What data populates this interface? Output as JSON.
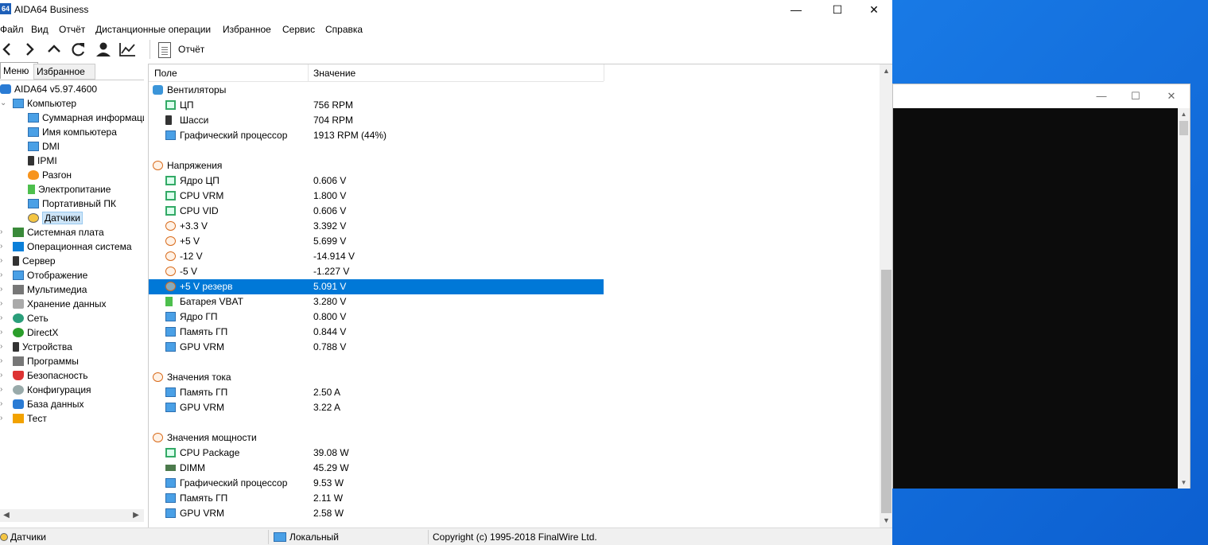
{
  "window": {
    "title": "AIDA64 Business",
    "icon_text": "64",
    "minimize": "—",
    "maximize": "☐",
    "close": "✕"
  },
  "menu": [
    "Файл",
    "Вид",
    "Отчёт",
    "Дистанционные операции",
    "Избранное",
    "Сервис",
    "Справка"
  ],
  "toolbar": {
    "report_label": "Отчёт",
    "buttons": [
      "back-icon",
      "forward-icon",
      "up-icon",
      "refresh-icon",
      "user-icon",
      "chart-icon"
    ]
  },
  "tabs": {
    "menu": "Меню",
    "favorites": "Избранное"
  },
  "tree": {
    "root": "AIDA64 v5.97.4600",
    "computer": "Компьютер",
    "computer_children": [
      {
        "label": "Суммарная информация",
        "icon": "monitor-icon"
      },
      {
        "label": "Имя компьютера",
        "icon": "monitor-icon"
      },
      {
        "label": "DMI",
        "icon": "monitor-icon"
      },
      {
        "label": "IPMI",
        "icon": "tower-icon"
      },
      {
        "label": "Разгон",
        "icon": "fire-icon"
      },
      {
        "label": "Электропитание",
        "icon": "battery-icon"
      },
      {
        "label": "Портативный ПК",
        "icon": "monitor-icon"
      },
      {
        "label": "Датчики",
        "icon": "gauge-icon"
      }
    ],
    "top_items": [
      {
        "label": "Системная плата",
        "icon": "motherboard-icon"
      },
      {
        "label": "Операционная система",
        "icon": "windows-icon"
      },
      {
        "label": "Сервер",
        "icon": "tower-icon"
      },
      {
        "label": "Отображение",
        "icon": "monitor-icon"
      },
      {
        "label": "Мультимедиа",
        "icon": "speaker-icon"
      },
      {
        "label": "Хранение данных",
        "icon": "disk-icon"
      },
      {
        "label": "Сеть",
        "icon": "network-icon"
      },
      {
        "label": "DirectX",
        "icon": "xbox-icon"
      },
      {
        "label": "Устройства",
        "icon": "device-icon"
      },
      {
        "label": "Программы",
        "icon": "program-icon"
      },
      {
        "label": "Безопасность",
        "icon": "shield-icon"
      },
      {
        "label": "Конфигурация",
        "icon": "gear-icon"
      },
      {
        "label": "База данных",
        "icon": "database-icon"
      },
      {
        "label": "Тест",
        "icon": "test-icon"
      }
    ]
  },
  "list": {
    "col_field": "Поле",
    "col_value": "Значение",
    "groups": [
      {
        "title": "Вентиляторы",
        "icon": "fan-icon",
        "rows": [
          {
            "field": "ЦП",
            "value": "756 RPM",
            "icon": "chip-icon"
          },
          {
            "field": "Шасси",
            "value": "704 RPM",
            "icon": "tower-icon"
          },
          {
            "field": "Графический процессор",
            "value": "1913 RPM  (44%)",
            "icon": "monitor-icon"
          }
        ]
      },
      {
        "title": "Напряжения",
        "icon": "bolt-icon",
        "rows": [
          {
            "field": "Ядро ЦП",
            "value": "0.606 V",
            "icon": "chip-icon"
          },
          {
            "field": "CPU VRM",
            "value": "1.800 V",
            "icon": "chip-icon"
          },
          {
            "field": "CPU VID",
            "value": "0.606 V",
            "icon": "chip-icon"
          },
          {
            "field": "+3.3 V",
            "value": "3.392 V",
            "icon": "bolt-icon"
          },
          {
            "field": "+5 V",
            "value": "5.699 V",
            "icon": "bolt-icon"
          },
          {
            "field": "-12 V",
            "value": "-14.914 V",
            "icon": "bolt-icon"
          },
          {
            "field": "-5 V",
            "value": "-1.227 V",
            "icon": "bolt-icon"
          },
          {
            "field": "+5 V резерв",
            "value": "5.091 V",
            "icon": "bolt-icon",
            "selected": true
          },
          {
            "field": "Батарея VBAT",
            "value": "3.280 V",
            "icon": "battery-icon"
          },
          {
            "field": "Ядро ГП",
            "value": "0.800 V",
            "icon": "monitor-icon"
          },
          {
            "field": "Память ГП",
            "value": "0.844 V",
            "icon": "monitor-icon"
          },
          {
            "field": "GPU VRM",
            "value": "0.788 V",
            "icon": "monitor-icon"
          }
        ]
      },
      {
        "title": "Значения тока",
        "icon": "bolt-icon",
        "rows": [
          {
            "field": "Память ГП",
            "value": "2.50 A",
            "icon": "monitor-icon"
          },
          {
            "field": "GPU VRM",
            "value": "3.22 A",
            "icon": "monitor-icon"
          }
        ]
      },
      {
        "title": "Значения мощности",
        "icon": "bolt-icon",
        "rows": [
          {
            "field": "CPU Package",
            "value": "39.08 W",
            "icon": "chip-icon"
          },
          {
            "field": "DIMM",
            "value": "45.29 W",
            "icon": "ram-icon"
          },
          {
            "field": "Графический процессор",
            "value": "9.53 W",
            "icon": "monitor-icon"
          },
          {
            "field": "Память ГП",
            "value": "2.11 W",
            "icon": "monitor-icon"
          },
          {
            "field": "GPU VRM",
            "value": "2.58 W",
            "icon": "monitor-icon"
          }
        ]
      }
    ]
  },
  "status": {
    "left": "Датчики",
    "middle": "Локальный",
    "right": "Copyright (c) 1995-2018 FinalWire Ltd."
  },
  "console_window": {
    "minimize": "—",
    "maximize": "☐",
    "close": "✕"
  },
  "colors": {
    "selection": "#0078d7",
    "desktop": "#0a63d6",
    "console_bg": "#0c0c0c"
  }
}
